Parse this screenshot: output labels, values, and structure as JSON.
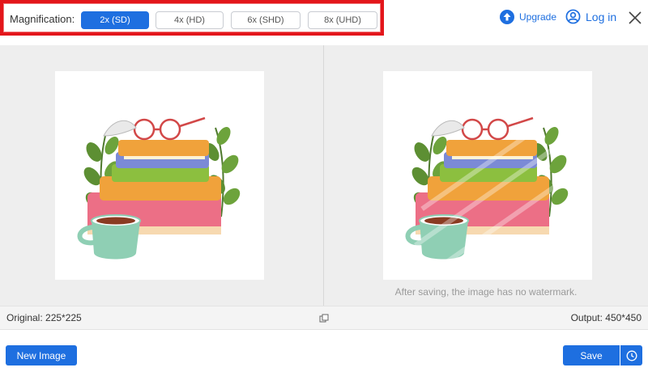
{
  "toolbar": {
    "magnification_label": "Magnification:",
    "options": [
      {
        "label": "2x (SD)",
        "active": true
      },
      {
        "label": "4x (HD)",
        "active": false
      },
      {
        "label": "6x (SHD)",
        "active": false
      },
      {
        "label": "8x (UHD)",
        "active": false
      }
    ],
    "upgrade_label": "Upgrade",
    "login_label": "Log in",
    "icons": {
      "upgrade": "upload-circle-icon",
      "login": "user-circle-icon",
      "close": "close-icon"
    }
  },
  "preview": {
    "watermark_note": "After saving, the image has no watermark.",
    "original_image": "books-teacup-illustration",
    "output_image": "books-teacup-illustration-watermarked"
  },
  "info": {
    "original": "Original: 225*225",
    "output": "Output: 450*450",
    "compare_icon": "compare-icon"
  },
  "actions": {
    "new_image": "New Image",
    "save": "Save",
    "history_icon": "clock-icon"
  },
  "colors": {
    "accent": "#1e6fe0",
    "highlight_border": "#e3161b"
  }
}
